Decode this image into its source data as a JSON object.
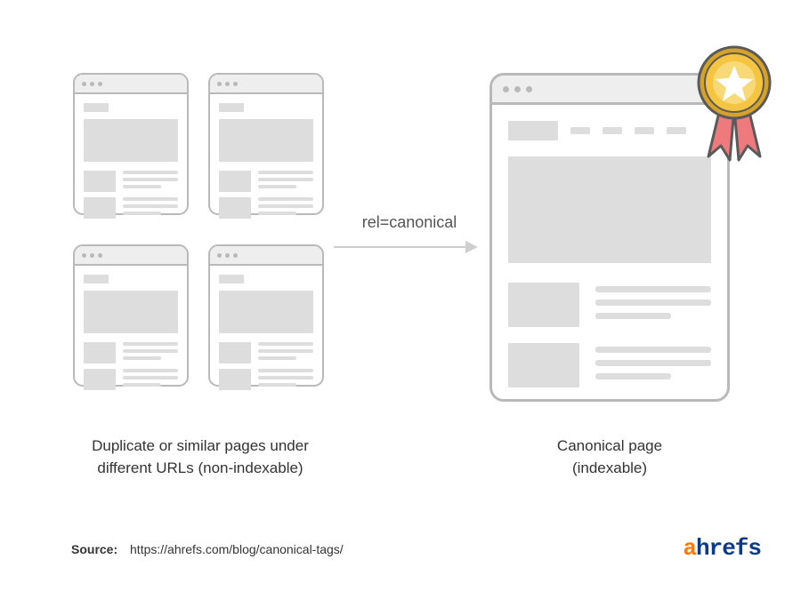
{
  "arrow_label": "rel=canonical",
  "captions": {
    "left_line1": "Duplicate or similar pages under",
    "left_line2": "different URLs (non-indexable)",
    "right_line1": "Canonical page",
    "right_line2": "(indexable)"
  },
  "source": {
    "label": "Source:",
    "url": "https://ahrefs.com/blog/canonical-tags/"
  },
  "brand": {
    "first": "a",
    "rest": "hrefs"
  },
  "colors": {
    "outline": "#b9b9b9",
    "fill": "#dddddd",
    "arrow": "#cfcfcf",
    "brand_orange": "#ff7a00",
    "brand_blue": "#0a3a8a",
    "ribbon": "#ef7a7d",
    "coin_gold": "#f5c542",
    "coin_gold_dark": "#d7a326"
  }
}
